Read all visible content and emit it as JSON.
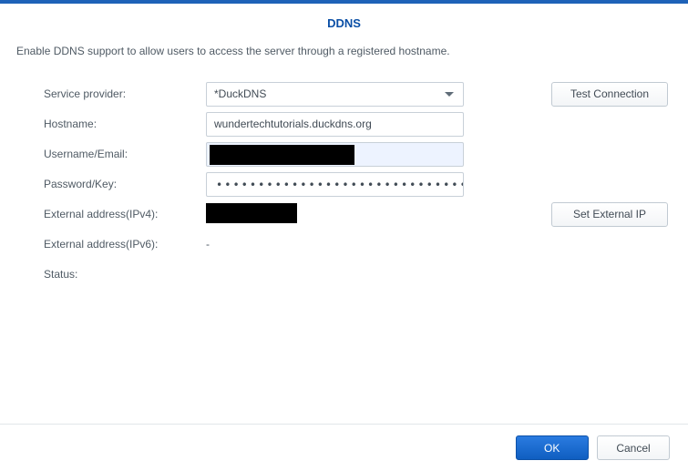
{
  "header": {
    "title": "DDNS"
  },
  "description": "Enable DDNS support to allow users to access the server through a registered hostname.",
  "labels": {
    "serviceProvider": "Service provider:",
    "hostname": "Hostname:",
    "username": "Username/Email:",
    "password": "Password/Key:",
    "extIPv4": "External address(IPv4):",
    "extIPv6": "External address(IPv6):",
    "status": "Status:"
  },
  "fields": {
    "serviceProvider": "*DuckDNS",
    "hostname": "wundertechtutorials.duckdns.org",
    "passwordMask": "•••••••••••••••••••••••••••••••••",
    "extIPv6": "-",
    "status": ""
  },
  "buttons": {
    "testConnection": "Test Connection",
    "setExternalIP": "Set External IP",
    "ok": "OK",
    "cancel": "Cancel"
  }
}
